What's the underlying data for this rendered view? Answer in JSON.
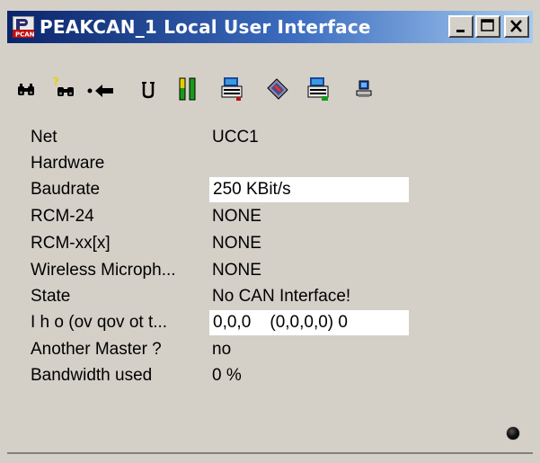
{
  "window": {
    "title": "PEAKCAN_1 Local User Interface",
    "title_buttons": [
      "minimize",
      "maximize",
      "close"
    ]
  },
  "toolbar": {
    "icons": [
      "binoculars-icon",
      "search-unknown-icon",
      "arrow-left-icon",
      "u-icon",
      "level-bars-icon",
      "device-card-icon",
      "network-device-icon",
      "device-card-2-icon",
      "computer-icon"
    ]
  },
  "properties": [
    {
      "label": "Net",
      "value": "UCC1",
      "field": false
    },
    {
      "label": "Hardware",
      "value": "",
      "field": false
    },
    {
      "label": "Baudrate",
      "value": "250 KBit/s",
      "field": true
    },
    {
      "label": "RCM-24",
      "value": "NONE",
      "field": false
    },
    {
      "label": "RCM-xx[x]",
      "value": "NONE",
      "field": false
    },
    {
      "label": "Wireless Microph...",
      "value": "NONE",
      "field": false
    },
    {
      "label": "State",
      "value": "No CAN Interface!",
      "field": false
    },
    {
      "label": "I h o (ov qov ot t...",
      "value": "0,0,0    (0,0,0,0) 0",
      "field": true
    },
    {
      "label": "Another Master ?",
      "value": "no",
      "field": false
    },
    {
      "label": "Bandwidth used",
      "value": "0 %",
      "field": false
    }
  ],
  "colors": {
    "title_start": "#0a246a",
    "title_end": "#a6caf0",
    "face": "#d4d0c8"
  }
}
